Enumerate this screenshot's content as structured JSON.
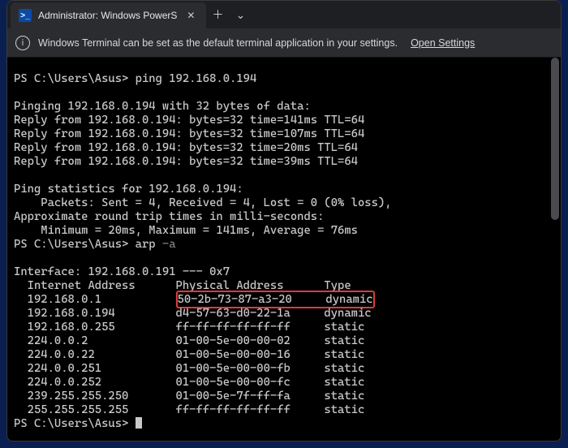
{
  "titlebar": {
    "tab_title": "Administrator: Windows PowerS",
    "icon_label": ">_"
  },
  "infobar": {
    "message": "Windows Terminal can be set as the default terminal application in your settings.",
    "link": "Open Settings"
  },
  "term": {
    "prompt1": "PS C:\\Users\\Asus> ",
    "cmd1": "ping 192.168.0.194",
    "blank": "",
    "ping_header": "Pinging 192.168.0.194 with 32 bytes of data:",
    "reply1": "Reply from 192.168.0.194: bytes=32 time=141ms TTL=64",
    "reply2": "Reply from 192.168.0.194: bytes=32 time=107ms TTL=64",
    "reply3": "Reply from 192.168.0.194: bytes=32 time=20ms TTL=64",
    "reply4": "Reply from 192.168.0.194: bytes=32 time=39ms TTL=64",
    "stats_header": "Ping statistics for 192.168.0.194:",
    "stats_packets": "    Packets: Sent = 4, Received = 4, Lost = 0 (0% loss),",
    "rtt_header": "Approximate round trip times in milli-seconds:",
    "rtt_values": "    Minimum = 20ms, Maximum = 141ms, Average = 76ms",
    "prompt2": "PS C:\\Users\\Asus> ",
    "cmd2": "arp ",
    "cmd2_flag": "-a",
    "iface": "Interface: 192.168.0.191 --- 0x7",
    "arp_header": "  Internet Address      Physical Address      Type",
    "arp_r0_ip": "  192.168.0.1           ",
    "arp_r0_mac": "50-2b-73-87-a3-20     dynamic",
    "arp_r1": "  192.168.0.194         d4-57-63-d0-22-1a     dynamic",
    "arp_r2": "  192.168.0.255         ff-ff-ff-ff-ff-ff     static",
    "arp_r3": "  224.0.0.2             01-00-5e-00-00-02     static",
    "arp_r4": "  224.0.0.22            01-00-5e-00-00-16     static",
    "arp_r5": "  224.0.0.251           01-00-5e-00-00-fb     static",
    "arp_r6": "  224.0.0.252           01-00-5e-00-00-fc     static",
    "arp_r7": "  239.255.255.250       01-00-5e-7f-ff-fa     static",
    "arp_r8": "  255.255.255.255       ff-ff-ff-ff-ff-ff     static",
    "prompt3": "PS C:\\Users\\Asus> "
  }
}
